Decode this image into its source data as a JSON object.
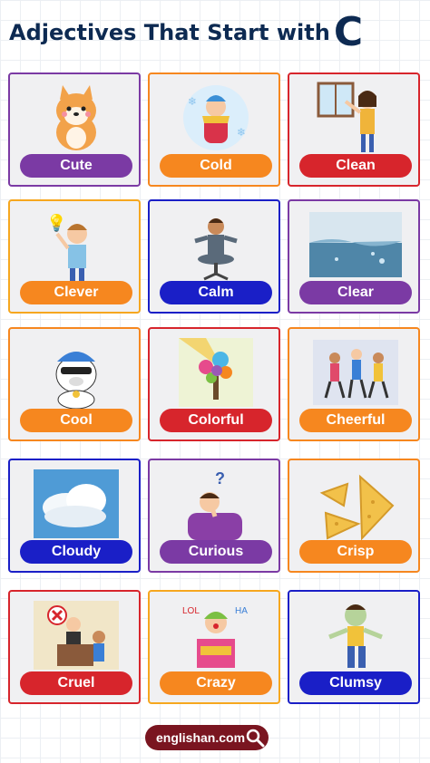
{
  "title": {
    "text": "Adjectives That Start with",
    "letter": "C"
  },
  "cards": [
    {
      "label": "Cute",
      "border": "#7b3aa4",
      "label_bg": "#7b3aa4",
      "icon": "cute-dog-icon"
    },
    {
      "label": "Cold",
      "border": "#f6871f",
      "label_bg": "#f6871f",
      "icon": "cold-person-icon"
    },
    {
      "label": "Clean",
      "border": "#d7252c",
      "label_bg": "#d7252c",
      "icon": "cleaning-girl-icon"
    },
    {
      "label": "Clever",
      "border": "#f6a71f",
      "label_bg": "#f6871f",
      "icon": "clever-boy-icon"
    },
    {
      "label": "Calm",
      "border": "#1a1fc7",
      "label_bg": "#1a1fc7",
      "icon": "meditating-man-icon"
    },
    {
      "label": "Clear",
      "border": "#7b3aa4",
      "label_bg": "#7b3aa4",
      "icon": "clear-water-icon"
    },
    {
      "label": "Cool",
      "border": "#f6871f",
      "label_bg": "#f6871f",
      "icon": "cool-bear-icon"
    },
    {
      "label": "Colorful",
      "border": "#d7252c",
      "label_bg": "#d7252c",
      "icon": "colorful-tree-icon"
    },
    {
      "label": "Cheerful",
      "border": "#f6871f",
      "label_bg": "#f6871f",
      "icon": "cheerful-people-icon"
    },
    {
      "label": "Cloudy",
      "border": "#1a1fc7",
      "label_bg": "#1a1fc7",
      "icon": "cloudy-sky-icon"
    },
    {
      "label": "Curious",
      "border": "#7b3aa4",
      "label_bg": "#7b3aa4",
      "icon": "curious-man-icon"
    },
    {
      "label": "Crisp",
      "border": "#f6871f",
      "label_bg": "#f6871f",
      "icon": "crisp-chips-icon"
    },
    {
      "label": "Cruel",
      "border": "#d7252c",
      "label_bg": "#d7252c",
      "icon": "cruel-boss-icon"
    },
    {
      "label": "Crazy",
      "border": "#f6a71f",
      "label_bg": "#f6871f",
      "icon": "crazy-clown-icon"
    },
    {
      "label": "Clumsy",
      "border": "#1a1fc7",
      "label_bg": "#1a1fc7",
      "icon": "clumsy-zombie-icon"
    }
  ],
  "footer": {
    "text": "englishan.com",
    "icon": "search-icon"
  }
}
